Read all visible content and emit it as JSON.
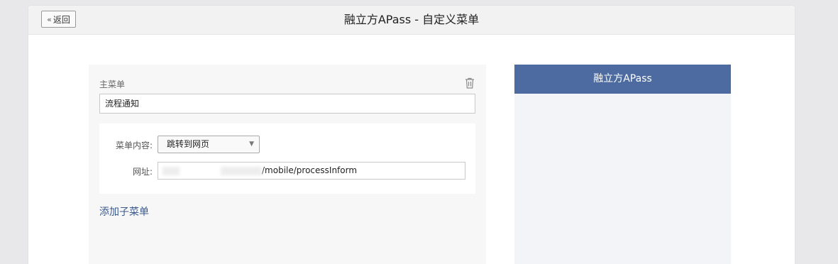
{
  "header": {
    "back_label": "返回",
    "back_icon": "double-chevron-left-icon",
    "title": "融立方APass - 自定义菜单"
  },
  "editor": {
    "main_menu_label": "主菜单",
    "main_menu_value": "流程通知",
    "delete_icon": "trash-icon",
    "content_label": "菜单内容:",
    "content_selected": "跳转到网页",
    "url_label": "网址:",
    "url_value": "/mobile/processInform",
    "add_submenu_label": "添加子菜单"
  },
  "preview": {
    "title": "融立方APass"
  },
  "colors": {
    "accent": "#4d6ba0",
    "link": "#3d5a8e",
    "panel_bg": "#f7f7f7"
  }
}
